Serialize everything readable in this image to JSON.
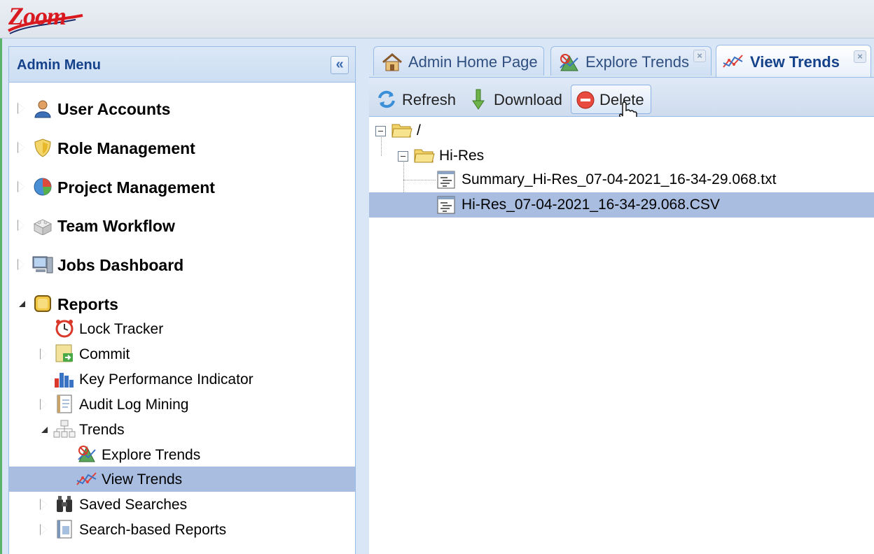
{
  "app": {
    "logo_text": "Zoom"
  },
  "admin_menu": {
    "title": "Admin Menu",
    "collapse_glyph": "«",
    "items": [
      {
        "label": "User Accounts",
        "icon": "user-icon"
      },
      {
        "label": "Role Management",
        "icon": "shield-icon"
      },
      {
        "label": "Project Management",
        "icon": "pie-chart-icon"
      },
      {
        "label": "Team Workflow",
        "icon": "blocks-icon"
      },
      {
        "label": "Jobs Dashboard",
        "icon": "computer-icon"
      },
      {
        "label": "Reports",
        "icon": "reports-icon"
      }
    ],
    "reports_children": [
      {
        "label": "Lock Tracker",
        "icon": "alarm-clock-icon"
      },
      {
        "label": "Commit",
        "icon": "commit-icon"
      },
      {
        "label": "Key Performance Indicator",
        "icon": "bar-chart-icon"
      },
      {
        "label": "Audit Log Mining",
        "icon": "notebook-icon"
      },
      {
        "label": "Trends",
        "icon": "trends-icon"
      },
      {
        "label": "Saved Searches",
        "icon": "binoculars-icon"
      },
      {
        "label": "Search-based Reports",
        "icon": "report-doc-icon"
      }
    ],
    "trends_children": [
      {
        "label": "Explore Trends",
        "icon": "explore-trends-icon"
      },
      {
        "label": "View Trends",
        "icon": "view-trends-icon"
      }
    ]
  },
  "tabs": [
    {
      "label": "Admin Home Page",
      "icon": "home-icon"
    },
    {
      "label": "Explore Trends",
      "icon": "explore-trends-icon",
      "close": "×"
    },
    {
      "label": "View Trends",
      "icon": "view-trends-icon",
      "close": "×"
    }
  ],
  "toolbar": {
    "refresh_label": "Refresh",
    "download_label": "Download",
    "delete_label": "Delete"
  },
  "tree": {
    "root_label": "/",
    "folder_label": "Hi-Res",
    "files": [
      "Summary_Hi-Res_07-04-2021_16-34-29.068.txt",
      "Hi-Res_07-04-2021_16-34-29.068.CSV"
    ]
  },
  "colors": {
    "selection": "#a8bde0",
    "header_text": "#15428b",
    "logo_red": "#d8191f"
  }
}
